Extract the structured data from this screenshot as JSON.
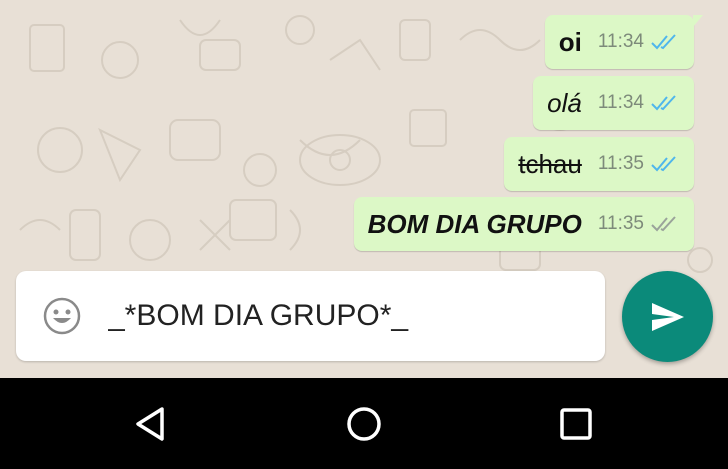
{
  "messages": [
    {
      "text": "oi",
      "time": "11:34",
      "status": "read"
    },
    {
      "text": "olá",
      "time": "11:34",
      "status": "read"
    },
    {
      "text": "tchau",
      "time": "11:35",
      "status": "read"
    },
    {
      "text": "BOM DIA GRUPO",
      "time": "11:35",
      "status": "delivered"
    }
  ],
  "composer": {
    "value": "_*BOM DIA GRUPO*_",
    "emoji_icon": "smiley-icon",
    "send_icon": "send-icon"
  },
  "navbar": {
    "back_icon": "back-triangle-icon",
    "home_icon": "home-circle-icon",
    "recents_icon": "recents-square-icon"
  },
  "colors": {
    "bubble": "#dcf8c6",
    "read_ticks": "#4fb6ec",
    "delivered_ticks": "#9aa39a",
    "send_button": "#0b8a7a",
    "chat_background": "#e8e0d6"
  }
}
